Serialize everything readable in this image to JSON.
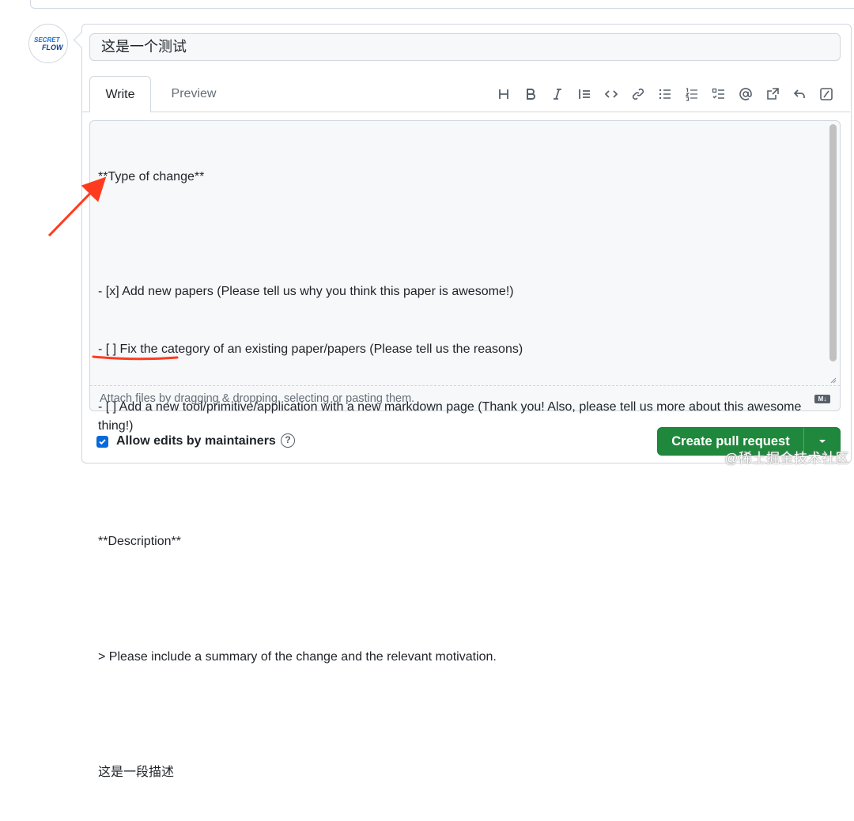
{
  "comment_form": {
    "title_value": "这是一个测试",
    "tabs": [
      {
        "label": "Write",
        "active": true
      },
      {
        "label": "Preview",
        "active": false
      }
    ],
    "toolbar_icons": [
      "heading-icon",
      "bold-icon",
      "italic-icon",
      "quote-icon",
      "code-icon",
      "link-icon",
      "bulleted-list-icon",
      "numbered-list-icon",
      "task-list-icon",
      "mention-icon",
      "reference-icon",
      "undo-icon",
      "slash-commands-icon"
    ],
    "body_lines": [
      "**Type of change**",
      "",
      "- [x] Add new papers (Please tell us why you think this paper is awesome!)",
      "- [ ] Fix the category of an existing paper/papers (Please tell us the reasons)",
      "- [ ] Add a new tool/primitive/application with a new markdown page (Thank you! Also, please tell us more about this awesome thing!)",
      "",
      "**Description**",
      "",
      "> Please include a summary of the change and the relevant motivation.",
      "",
      "这是一段描述"
    ],
    "attach_hint": "Attach files by dragging & dropping, selecting or pasting them.",
    "markdown_badge": "M↓"
  },
  "footer": {
    "allow_edits_label": "Allow edits by maintainers",
    "allow_edits_checked": true,
    "help_glyph": "?",
    "create_button_label": "Create pull request"
  },
  "avatar": {
    "line1": "SECRET",
    "line2": "FLOW"
  },
  "watermark": "@稀土掘金技术社区",
  "colors": {
    "primary": "#1f883d",
    "checkbox": "#0969da",
    "annotation": "#ff3b1f"
  }
}
